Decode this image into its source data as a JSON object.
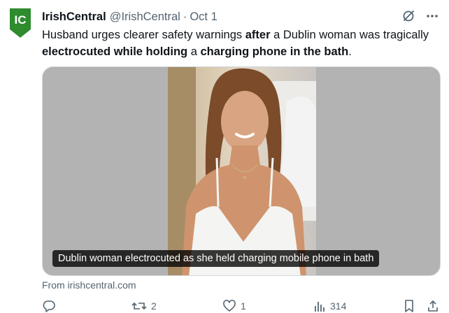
{
  "tweet": {
    "author_name": "IrishCentral",
    "author_handle": "@IrishCentral",
    "separator": "·",
    "date": "Oct 1",
    "text_segments": [
      {
        "text": "Husband urges clearer safety warnings ",
        "bold": false
      },
      {
        "text": "after",
        "bold": true
      },
      {
        "text": " a Dublin woman was tragically ",
        "bold": false
      },
      {
        "text": "electrocuted while holding",
        "bold": true
      },
      {
        "text": " a ",
        "bold": false
      },
      {
        "text": "charging phone in the bath",
        "bold": true
      },
      {
        "text": ".",
        "bold": false
      }
    ],
    "media_caption": "Dublin woman electrocuted as she held charging mobile phone in bath",
    "source": "From irishcentral.com"
  },
  "avatar": {
    "text": "IC",
    "color": "#2e8b2e"
  },
  "actions": {
    "reply_count": "",
    "retweet_count": "2",
    "like_count": "1",
    "views_count": "314"
  },
  "colors": {
    "text": "#0f1419",
    "muted": "#536471",
    "media_bg": "#b3b3b3"
  }
}
